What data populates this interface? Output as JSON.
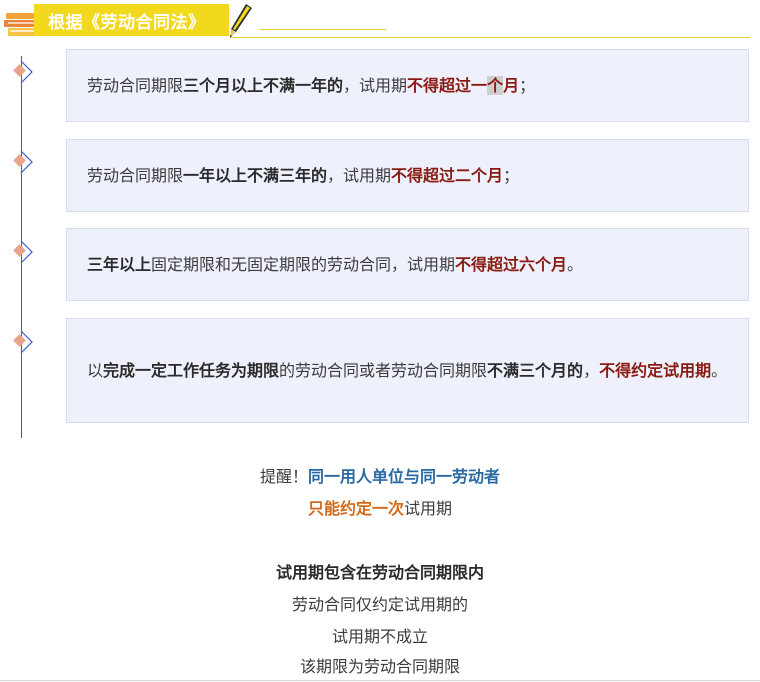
{
  "header": {
    "title": "根据《劳动合同法》",
    "book_icon": "books-icon",
    "pen_icon": "pen-icon"
  },
  "rules": [
    {
      "parts": [
        {
          "t": "劳动合同期限",
          "s": "n"
        },
        {
          "t": "三个月以上不满一年的",
          "s": "b"
        },
        {
          "t": "，试用期",
          "s": "n"
        },
        {
          "t": "不得超过一",
          "s": "r"
        },
        {
          "t": "个",
          "s": "rh"
        },
        {
          "t": "月",
          "s": "r"
        },
        {
          "t": "；",
          "s": "n"
        }
      ]
    },
    {
      "parts": [
        {
          "t": "劳动合同期限",
          "s": "n"
        },
        {
          "t": "一年以上不满三年的",
          "s": "b"
        },
        {
          "t": "，试用期",
          "s": "n"
        },
        {
          "t": "不得超过二个月",
          "s": "r"
        },
        {
          "t": "；",
          "s": "n"
        }
      ]
    },
    {
      "parts": [
        {
          "t": "三年以上",
          "s": "b"
        },
        {
          "t": "固定期限和无固定期限的劳动合同，试用期",
          "s": "n"
        },
        {
          "t": "不得超过六个月",
          "s": "r"
        },
        {
          "t": "。",
          "s": "n"
        }
      ]
    },
    {
      "parts": [
        {
          "t": "以",
          "s": "n"
        },
        {
          "t": "完成一定工作任务为期限",
          "s": "b"
        },
        {
          "t": "的劳动合同或者劳动合同期限",
          "s": "n"
        },
        {
          "t": "不满三个月的",
          "s": "b"
        },
        {
          "t": "，",
          "s": "n"
        },
        {
          "t": "不得约定试用期",
          "s": "r"
        },
        {
          "t": "。",
          "s": "n"
        }
      ]
    }
  ],
  "reminder": {
    "prefix": "提醒！",
    "highlight": "同一用人单位与同一劳动者",
    "line2_highlight": "只能约定一次",
    "line2_suffix": "试用期"
  },
  "notes": {
    "heading": "试用期包含在劳动合同期限内",
    "line1": "劳动合同仅约定试用期的",
    "line2": "试用期不成立",
    "line3": "该期限为劳动合同期限"
  },
  "colors": {
    "accent_yellow": "#f3d91d",
    "timeline_blue": "#3a5ad1",
    "emphasis_red": "#8a1b12",
    "card_bg": "#eef1fb",
    "reminder_blue": "#2a6aa3",
    "reminder_orange": "#d46a1a"
  }
}
